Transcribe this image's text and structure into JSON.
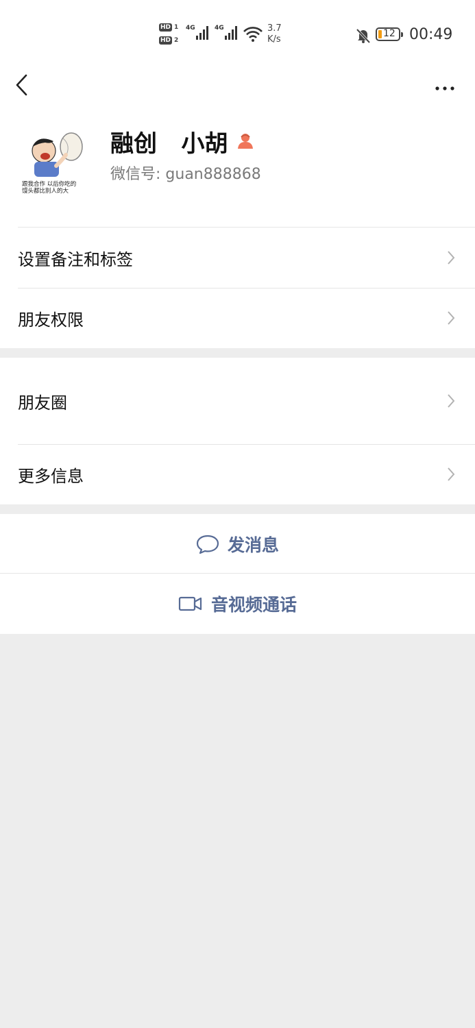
{
  "status_bar": {
    "sim1": "HD",
    "sim1_num": "1",
    "sim2": "HD",
    "sim2_num": "2",
    "network1": "4G",
    "network2": "4G",
    "speed_value": "3.7",
    "speed_unit": "K/s",
    "battery": "12",
    "time": "00:49",
    "battery_color": "#f39c12"
  },
  "header": {
    "back_icon": "chevron-left-icon",
    "more_icon": "more-dots-icon"
  },
  "profile": {
    "name": "融创   小胡",
    "gender_icon": "female-icon",
    "gender_color": "#f0765a",
    "wechat_id_label": "微信号:",
    "wechat_id": "guan888868",
    "avatar_caption_1": "跟我合作 以后你吃的",
    "avatar_caption_2": "馒头都比别人的大"
  },
  "menu_group1": [
    {
      "label": "设置备注和标签"
    },
    {
      "label": "朋友权限"
    }
  ],
  "menu_group2": [
    {
      "label": "朋友圈"
    },
    {
      "label": "更多信息"
    }
  ],
  "actions": {
    "message": "发消息",
    "video_call": "音视频通话",
    "accent_color": "#576b95"
  }
}
